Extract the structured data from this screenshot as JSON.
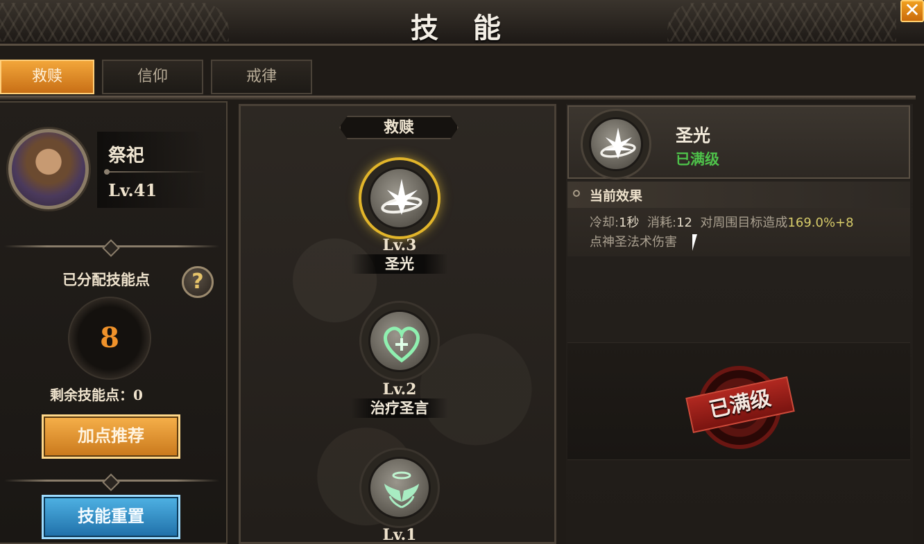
{
  "window": {
    "title": "技 能",
    "close_label": "✕"
  },
  "tabs": [
    {
      "label": "救赎",
      "active": true
    },
    {
      "label": "信仰",
      "active": false
    },
    {
      "label": "戒律",
      "active": false
    }
  ],
  "character": {
    "name": "祭祀",
    "level": "Lv.41"
  },
  "points": {
    "allocated_label": "已分配技能点",
    "allocated_value": "8",
    "remaining_label": "剩余技能点：0",
    "help_label": "?"
  },
  "buttons": {
    "recommend": "加点推荐",
    "reset": "技能重置"
  },
  "tree": {
    "header": "救赎",
    "nodes": [
      {
        "level": "Lv.3",
        "name": "圣光",
        "icon": "holy-light-icon",
        "selected": true
      },
      {
        "level": "Lv.2",
        "name": "治疗圣言",
        "icon": "heal-heart-icon",
        "selected": false
      },
      {
        "level": "Lv.1",
        "name": "",
        "icon": "angel-wings-icon",
        "selected": false
      }
    ]
  },
  "detail": {
    "name": "圣光",
    "status": "已满级",
    "effect_title": "当前效果",
    "effect_cd_label": "冷却:",
    "effect_cd_value": "1秒",
    "effect_cost_label": "消耗:",
    "effect_cost_value": "12",
    "effect_desc_pre": "对周围目标造成",
    "effect_desc_value": "169.0%+8",
    "effect_desc_post": "点神圣法术伤害",
    "stamp_text": "已满级"
  },
  "colors": {
    "accent_orange": "#e89a30",
    "accent_blue": "#2f8fca",
    "status_green": "#4ec24a",
    "selected_ring": "#e2b52a",
    "stamp_red": "#b02820"
  }
}
